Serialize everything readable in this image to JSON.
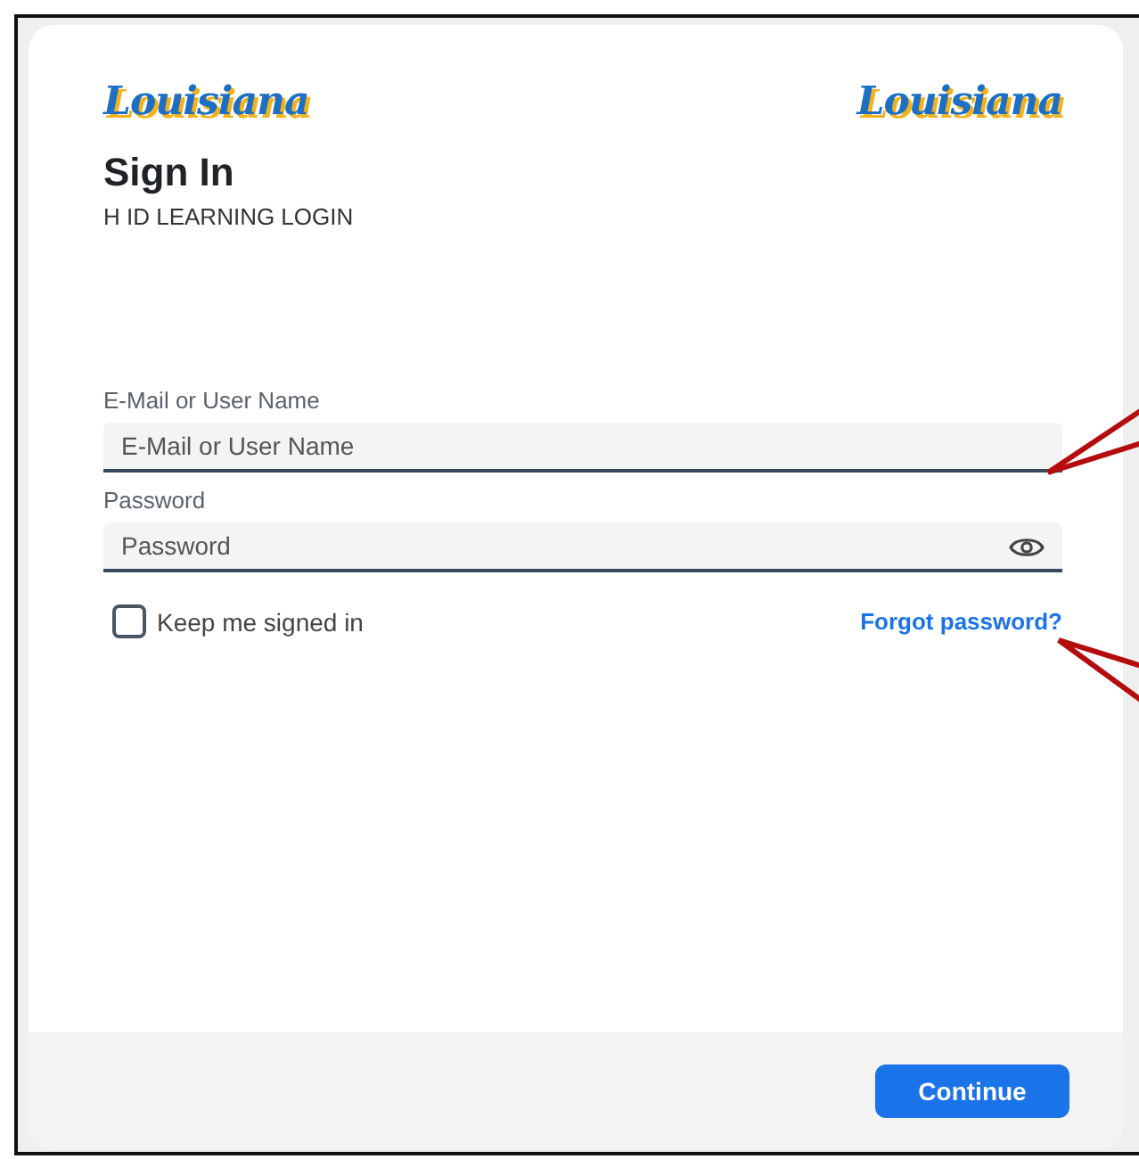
{
  "logos": [
    "Louisiana",
    "Louisiana"
  ],
  "title": "Sign In",
  "subtitle": "H ID LEARNING LOGIN",
  "fields": [
    {
      "kind": "text",
      "label": "E-Mail or User Name",
      "placeholder": "E-Mail or User Name"
    },
    {
      "kind": "password",
      "label": "Password",
      "placeholder": "Password"
    }
  ],
  "keep_signed_in": {
    "label": "Keep me signed in",
    "checked": false
  },
  "forgot_link": "Forgot password?",
  "continue_button": "Continue"
}
